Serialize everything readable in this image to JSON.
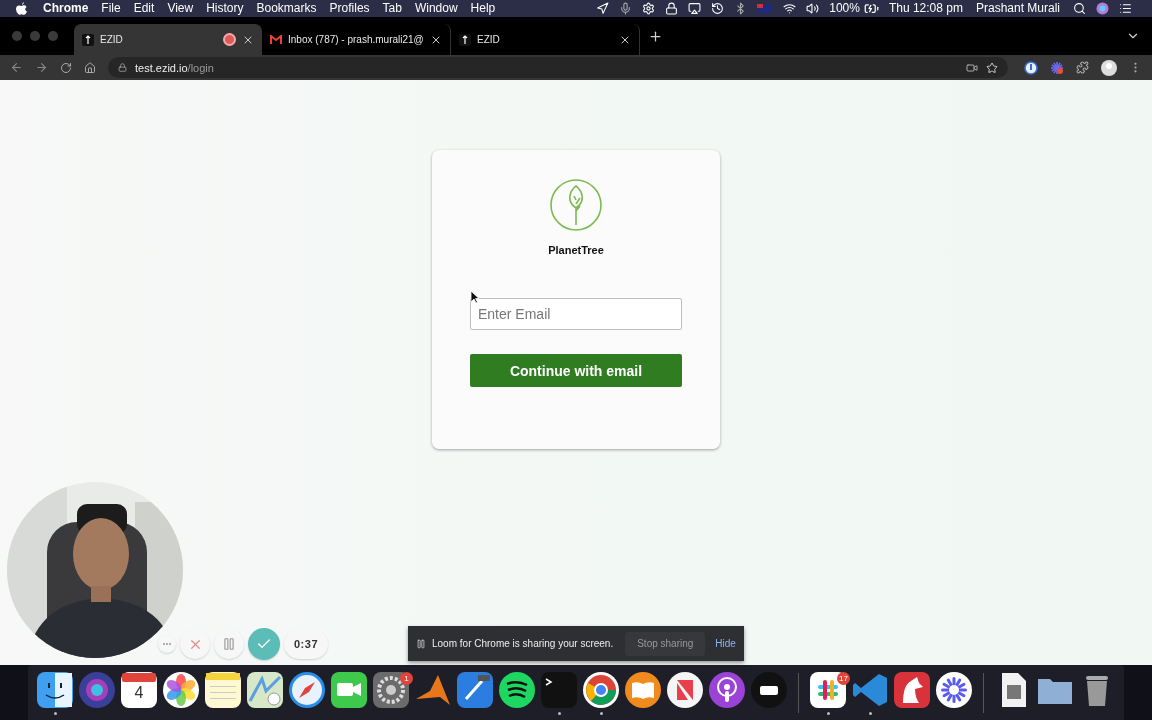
{
  "menu_bar": {
    "app": "Chrome",
    "menus": [
      "File",
      "Edit",
      "View",
      "History",
      "Bookmarks",
      "Profiles",
      "Tab",
      "Window",
      "Help"
    ],
    "battery": "100%",
    "clock": "Thu 12:08 pm",
    "user": "Prashant Murali"
  },
  "tabs": [
    {
      "title": "EZID",
      "kind": "site",
      "selected": true,
      "recording": true
    },
    {
      "title": "Inbox (787) - prash.murali21@",
      "kind": "mail",
      "selected": false,
      "recording": false
    },
    {
      "title": "EZID",
      "kind": "site",
      "selected": false,
      "recording": false
    }
  ],
  "address": {
    "host": "test.ezid.io",
    "path": "/login"
  },
  "login": {
    "brand": "PlanetTree",
    "email": {
      "placeholder": "Enter Email"
    },
    "button": "Continue with email"
  },
  "recorder": {
    "timer": "0:37"
  },
  "share_banner": {
    "message": "Loom for Chrome is sharing your screen.",
    "stop_button": "Stop sharing",
    "hide_link": "Hide"
  },
  "dock": {
    "groups": [
      [
        {
          "kind": "finder",
          "running": true
        },
        {
          "kind": "siri",
          "running": false
        },
        {
          "kind": "calendar",
          "running": false,
          "day": "4"
        },
        {
          "kind": "photos",
          "running": false
        },
        {
          "kind": "notes",
          "running": false
        },
        {
          "kind": "maps",
          "running": false
        },
        {
          "kind": "safari",
          "running": false
        },
        {
          "kind": "facetime",
          "running": false
        },
        {
          "kind": "settings",
          "running": false,
          "badge": "1"
        },
        {
          "kind": "matlab",
          "running": false
        },
        {
          "kind": "xcode",
          "running": false
        },
        {
          "kind": "spotify",
          "running": false
        },
        {
          "kind": "terminal",
          "running": true
        },
        {
          "kind": "chrome",
          "running": true
        },
        {
          "kind": "books",
          "running": false
        },
        {
          "kind": "news",
          "running": false
        },
        {
          "kind": "podcasts",
          "running": false
        },
        {
          "kind": "tv",
          "running": false
        }
      ],
      [
        {
          "kind": "slack",
          "running": true,
          "badge": "17"
        },
        {
          "kind": "vscode",
          "running": true
        },
        {
          "kind": "bear",
          "running": false
        },
        {
          "kind": "asterisk",
          "running": false
        }
      ],
      [
        {
          "kind": "file",
          "running": false
        },
        {
          "kind": "folder",
          "running": false
        },
        {
          "kind": "trash",
          "running": false
        }
      ]
    ]
  }
}
